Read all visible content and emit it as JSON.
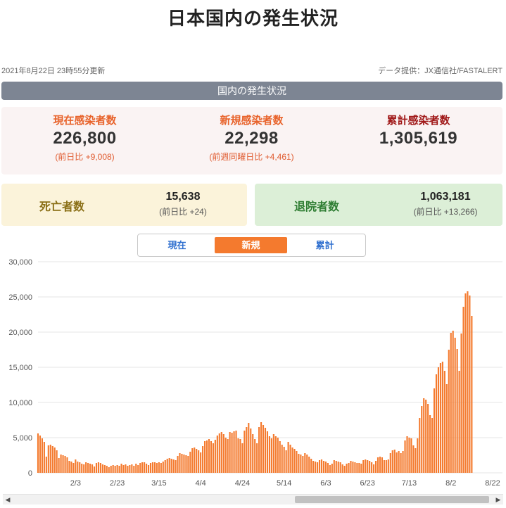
{
  "page": {
    "title": "日本国内の発生状況"
  },
  "meta": {
    "updated": "2021年8月22日 23時55分更新",
    "source": "データ提供：JX通信社/FASTALERT"
  },
  "section": {
    "title": "国内の発生状況"
  },
  "stats": {
    "current": {
      "label": "現在感染者数",
      "value": "226,800",
      "delta": "(前日比 +9,008)"
    },
    "new": {
      "label": "新規感染者数",
      "value": "22,298",
      "delta": "(前週同曜日比 +4,461)"
    },
    "total": {
      "label": "累計感染者数",
      "value": "1,305,619"
    }
  },
  "deaths": {
    "label": "死亡者数",
    "value": "15,638",
    "delta": "(前日比 +24)"
  },
  "recovered": {
    "label": "退院者数",
    "value": "1,063,181",
    "delta": "(前日比 +13,266)"
  },
  "tabs": [
    {
      "label": "現在",
      "active": false
    },
    {
      "label": "新規",
      "active": true
    },
    {
      "label": "累計",
      "active": false
    }
  ],
  "colors": {
    "bar": "#f47a2e",
    "accent": "#f47a2e",
    "tab_text": "#2f6fcf",
    "section_bar": "#7d8593"
  },
  "scrollbar": {
    "left_icon": "arrow-left-icon",
    "right_icon": "arrow-right-icon"
  },
  "chart_data": {
    "type": "bar",
    "title": "",
    "ylim": [
      0,
      30000
    ],
    "y_ticks": [
      "0",
      "5,000",
      "10,000",
      "15,000",
      "20,000",
      "25,000",
      "30,000"
    ],
    "x_ticks": [
      "2/3",
      "2/23",
      "3/15",
      "4/4",
      "4/24",
      "5/14",
      "6/3",
      "6/23",
      "7/13",
      "8/2",
      "8/22"
    ],
    "grid": true,
    "x_start": "2021-01-16",
    "x_end": "2021-08-22",
    "series": [
      {
        "values": [
          5600,
          5300,
          4900,
          4400,
          2300,
          3900,
          4000,
          3800,
          3600,
          3200,
          2100,
          2600,
          2500,
          2400,
          2200,
          1700,
          1600,
          1400,
          1900,
          1600,
          1500,
          1300,
          1200,
          1500,
          1400,
          1300,
          1200,
          900,
          1400,
          1500,
          1400,
          1200,
          1100,
          1000,
          800,
          1000,
          1100,
          1000,
          1100,
          1000,
          1300,
          1100,
          1200,
          1000,
          1100,
          1200,
          1000,
          1300,
          1100,
          1400,
          1500,
          1500,
          1300,
          1100,
          1400,
          1500,
          1500,
          1400,
          1500,
          1400,
          1600,
          1800,
          2000,
          2100,
          2000,
          1900,
          1800,
          2400,
          2800,
          2700,
          2600,
          2500,
          2400,
          3000,
          3500,
          3600,
          3400,
          3200,
          2900,
          3800,
          4500,
          4600,
          4800,
          4500,
          4200,
          4700,
          5300,
          5600,
          5800,
          5500,
          5000,
          4800,
          5800,
          5700,
          5900,
          6000,
          4900,
          4800,
          4200,
          6000,
          6500,
          7100,
          6300,
          5500,
          4800,
          4200,
          6500,
          7200,
          6800,
          6400,
          5900,
          5200,
          4900,
          5500,
          5200,
          5000,
          4500,
          4000,
          3700,
          3200,
          4400,
          4000,
          3600,
          3400,
          3100,
          2700,
          2600,
          2400,
          2800,
          2600,
          2300,
          2000,
          1700,
          1600,
          1500,
          1800,
          1900,
          1700,
          1600,
          1400,
          1100,
          1300,
          1800,
          1700,
          1600,
          1500,
          1200,
          1000,
          1300,
          1400,
          1700,
          1600,
          1500,
          1400,
          1400,
          1300,
          1800,
          1900,
          1800,
          1700,
          1500,
          1200,
          1700,
          2200,
          2300,
          2200,
          1800,
          1800,
          1900,
          2800,
          3200,
          3300,
          2900,
          3100,
          2800,
          3100,
          4600,
          5200,
          5000,
          4900,
          3900,
          3500,
          4900,
          7800,
          9500,
          10600,
          10400,
          9800,
          8200,
          7800,
          12000,
          14000,
          15000,
          15600,
          15800,
          14500,
          12600,
          17500,
          19900,
          20200,
          19200,
          17600,
          14500,
          19800,
          23600,
          25500,
          25800,
          25200,
          22300
        ]
      }
    ]
  }
}
